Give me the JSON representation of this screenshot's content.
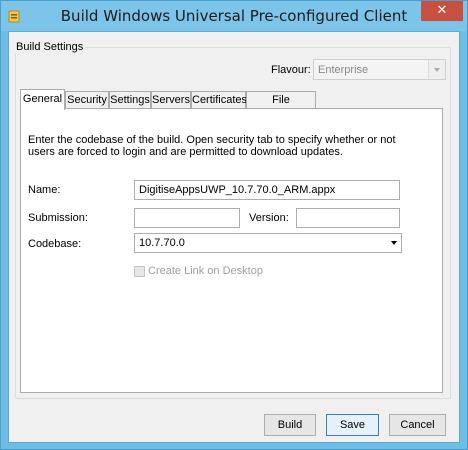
{
  "window": {
    "title": "Build Windows Universal Pre-configured Client",
    "close_glyph": "✕",
    "icon": "folder-app-icon"
  },
  "build_settings": {
    "group_label": "Build Settings",
    "flavour": {
      "label": "Flavour:",
      "value": "Enterprise",
      "disabled": true
    }
  },
  "tabs": [
    {
      "label": "General",
      "active": true
    },
    {
      "label": "Security",
      "active": false
    },
    {
      "label": "Settings",
      "active": false
    },
    {
      "label": "Servers",
      "active": false
    },
    {
      "label": "Certificates",
      "active": false
    },
    {
      "label": "File Extensions",
      "active": false
    }
  ],
  "general": {
    "description": "Enter the codebase of the build. Open security tab to specify whether or not users are forced to login and are permitted to download updates.",
    "name_label": "Name:",
    "name_value": "DigitiseAppsUWP_10.7.70.0_ARM.appx",
    "submission_label": "Submission:",
    "submission_value": "",
    "version_label": "Version:",
    "version_value": "",
    "codebase_label": "Codebase:",
    "codebase_value": "10.7.70.0",
    "create_link_label": "Create Link on Desktop",
    "create_link_checked": false,
    "create_link_disabled": true
  },
  "buttons": {
    "build": "Build",
    "save": "Save",
    "cancel": "Cancel"
  },
  "colors": {
    "title_bar": "#7cc4ea",
    "close_button": "#c7503f",
    "default_button_border": "#3c7fb1"
  }
}
